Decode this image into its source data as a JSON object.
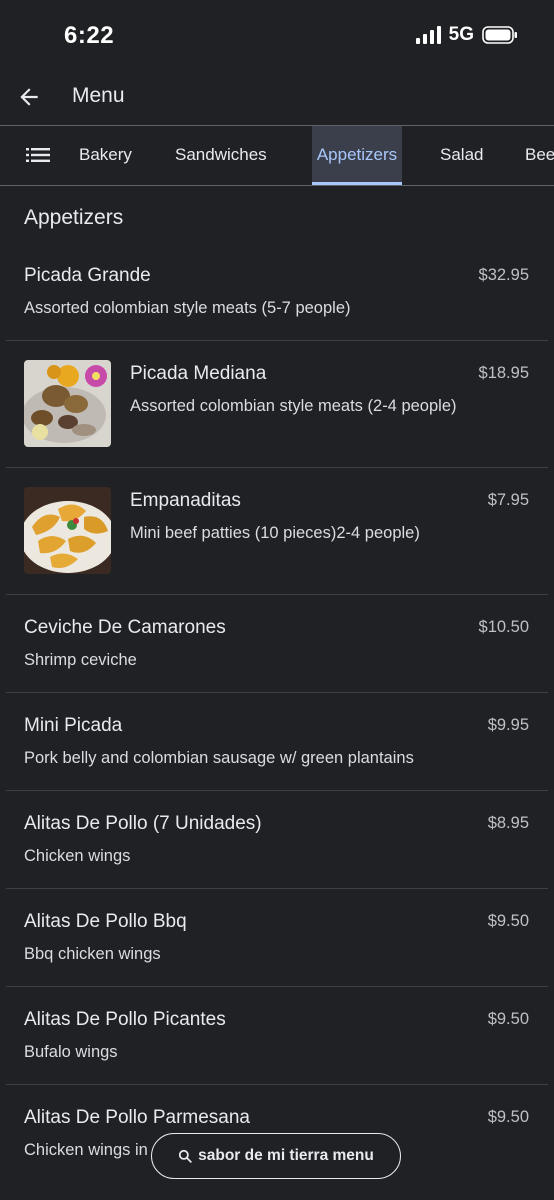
{
  "status_bar": {
    "time": "6:22",
    "network": "5G"
  },
  "app_bar": {
    "title": "Menu",
    "back_icon": "arrow-back-icon"
  },
  "tabs": {
    "list_icon": "list-icon",
    "items": [
      {
        "label": "Bakery",
        "active": false
      },
      {
        "label": "Sandwiches",
        "active": false
      },
      {
        "label": "Appetizers",
        "active": true
      },
      {
        "label": "Salad",
        "active": false
      },
      {
        "label": "Bee",
        "active": false
      }
    ],
    "active_color": "#a8c7fa"
  },
  "section": {
    "heading": "Appetizers"
  },
  "menu_items": [
    {
      "name": "Picada Grande",
      "description": "Assorted colombian style meats (5-7 people)",
      "price": "$32.95"
    },
    {
      "name": "Picada Mediana",
      "description": "Assorted colombian style meats (2-4 people)",
      "price": "$18.95"
    },
    {
      "name": "Empanaditas",
      "description": "Mini beef patties (10 pieces)2-4 people)",
      "price": "$7.95"
    },
    {
      "name": "Ceviche De Camarones",
      "description": "Shrimp ceviche",
      "price": "$10.50"
    },
    {
      "name": "Mini Picada",
      "description": "Pork belly and colombian sausage w/ green plantains",
      "price": "$9.95"
    },
    {
      "name": "Alitas De Pollo (7 Unidades)",
      "description": "Chicken wings",
      "price": "$8.95"
    },
    {
      "name": "Alitas De Pollo Bbq",
      "description": "Bbq chicken wings",
      "price": "$9.50"
    },
    {
      "name": "Alitas De Pollo Picantes",
      "description": "Bufalo wings",
      "price": "$9.50"
    },
    {
      "name": "Alitas De Pollo Parmesana",
      "description": "Chicken wings in",
      "price": "$9.50"
    }
  ],
  "search_chip": {
    "label": "sabor de mi tierra menu",
    "icon": "search-icon"
  },
  "colors": {
    "background": "#202124",
    "text": "#e8eaed",
    "divider": "#3c4043",
    "accent": "#a8c7fa"
  }
}
